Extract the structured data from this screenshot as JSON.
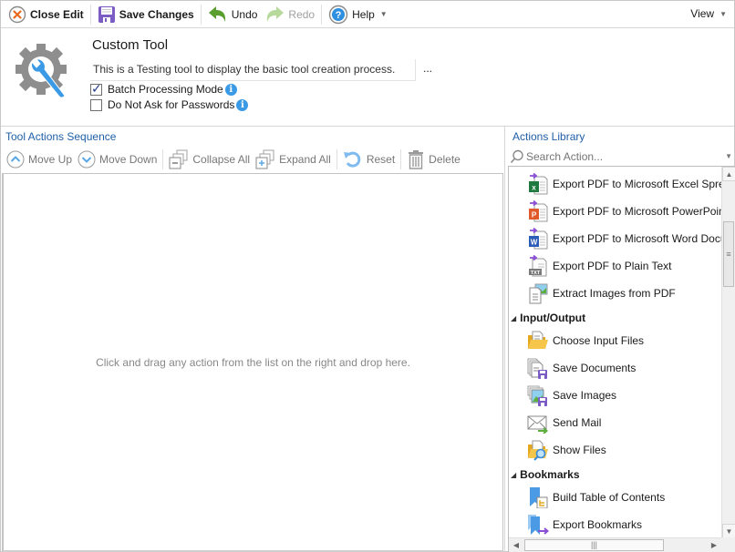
{
  "toolbar": {
    "close_edit": "Close Edit",
    "save_changes": "Save Changes",
    "undo": "Undo",
    "redo": "Redo",
    "help": "Help",
    "view": "View"
  },
  "tool": {
    "name": "Custom Tool",
    "description": "This is a Testing tool to display the basic tool creation process.",
    "more_label": "...",
    "options": [
      {
        "label": "Batch Processing Mode",
        "checked": true
      },
      {
        "label": "Do Not Ask for Passwords",
        "checked": false
      }
    ]
  },
  "sequence": {
    "title": "Tool Actions Sequence",
    "buttons": {
      "move_up": "Move Up",
      "move_down": "Move Down",
      "collapse_all": "Collapse All",
      "expand_all": "Expand All",
      "reset": "Reset",
      "delete": "Delete"
    },
    "empty_hint": "Click and drag any action from the list on the right and drop here."
  },
  "library": {
    "title": "Actions Library",
    "search_placeholder": "Search Action...",
    "items": [
      {
        "type": "item",
        "label": "Export PDF to Microsoft Excel Spreadsheet",
        "icon": "excel-export-icon"
      },
      {
        "type": "item",
        "label": "Export PDF to Microsoft PowerPoint",
        "icon": "powerpoint-export-icon"
      },
      {
        "type": "item",
        "label": "Export PDF to Microsoft Word Document",
        "icon": "word-export-icon"
      },
      {
        "type": "item",
        "label": "Export PDF to Plain Text",
        "icon": "text-export-icon"
      },
      {
        "type": "item",
        "label": "Extract Images from PDF",
        "icon": "extract-images-icon"
      },
      {
        "type": "group",
        "label": "Input/Output"
      },
      {
        "type": "item",
        "label": "Choose Input Files",
        "icon": "folder-open-icon"
      },
      {
        "type": "item",
        "label": "Save Documents",
        "icon": "save-documents-icon"
      },
      {
        "type": "item",
        "label": "Save Images",
        "icon": "save-images-icon"
      },
      {
        "type": "item",
        "label": "Send Mail",
        "icon": "mail-icon"
      },
      {
        "type": "item",
        "label": "Show Files",
        "icon": "folder-search-icon"
      },
      {
        "type": "group",
        "label": "Bookmarks"
      },
      {
        "type": "item",
        "label": "Build Table of Contents",
        "icon": "bookmark-toc-icon"
      },
      {
        "type": "item",
        "label": "Export Bookmarks",
        "icon": "bookmark-export-icon"
      }
    ]
  },
  "colors": {
    "accent_blue": "#1f5fa8",
    "undo_green": "#5a9e2f",
    "save_purple": "#7b5cc4",
    "close_orange": "#e86a1e"
  }
}
